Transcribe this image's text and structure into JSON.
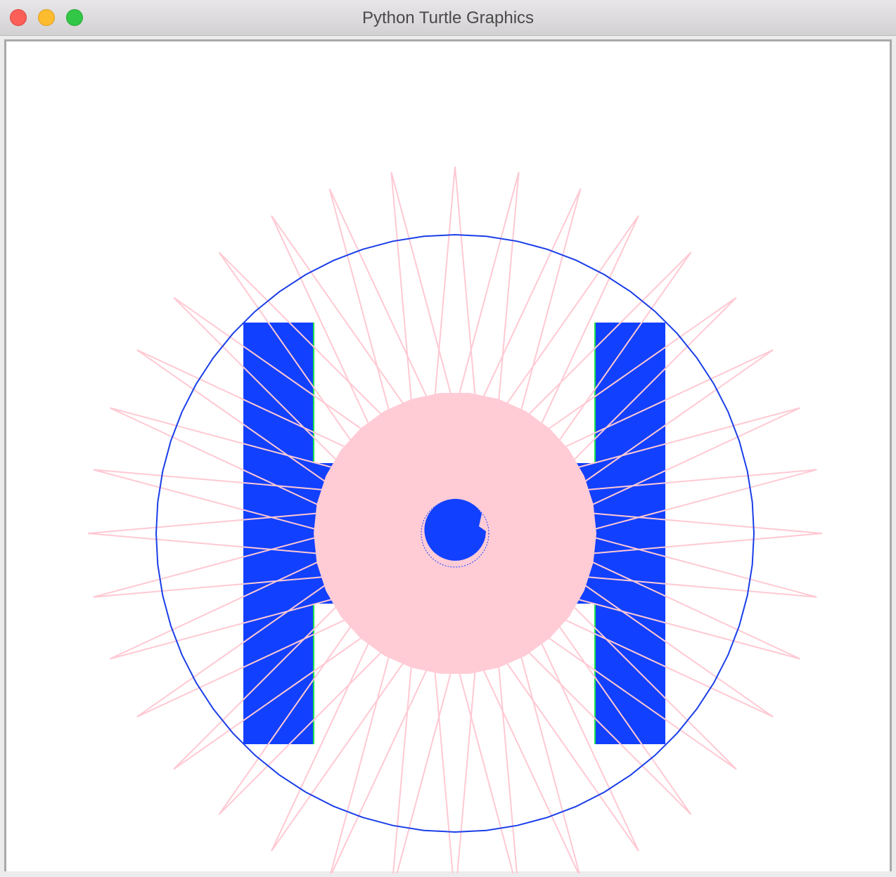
{
  "window": {
    "title": "Python Turtle Graphics"
  },
  "controls": {
    "close": "close-button",
    "minimize": "minimize-button",
    "zoom": "zoom-button"
  },
  "colors": {
    "letter_fill": "#1240ff",
    "circle_stroke": "#1a3ee8",
    "star_stroke": "#ffc9d3",
    "disc_fill": "#ffccd6",
    "inner_edge": "#19e04a",
    "window_bg": "#ececec",
    "canvas_bg": "#ffffff"
  },
  "drawing": {
    "shapes": [
      "letter H",
      "outer circle",
      "star burst",
      "pink disc",
      "blue dot"
    ]
  }
}
